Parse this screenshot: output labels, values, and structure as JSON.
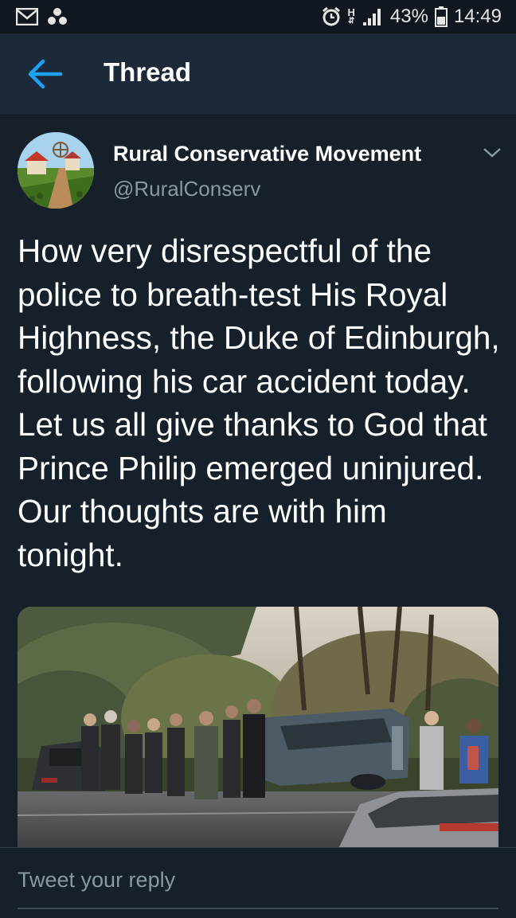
{
  "status_bar": {
    "network": "H",
    "battery": "43%",
    "time": "14:49",
    "icons": [
      "mail-icon",
      "dots-icon",
      "alarm-icon",
      "signal-icon",
      "battery-icon"
    ]
  },
  "header": {
    "title": "Thread",
    "back_icon": "arrow-left-icon"
  },
  "tweet": {
    "author_name": "Rural Conservative Movement",
    "author_handle": "@RuralConserv",
    "text": "How very disrespectful of the police to breath-test His Royal Highness, the Duke of Edinburgh, following his car accident today. Let us all give thanks to God that Prince Philip emerged uninjured. Our thoughts are with him tonight.",
    "media": "photo of overturned car on road with people standing nearby"
  },
  "reply": {
    "placeholder": "Tweet your reply"
  },
  "colors": {
    "background": "#15202b",
    "header": "#1c2938",
    "accent": "#1da1f2",
    "secondary_text": "#8899a6"
  }
}
